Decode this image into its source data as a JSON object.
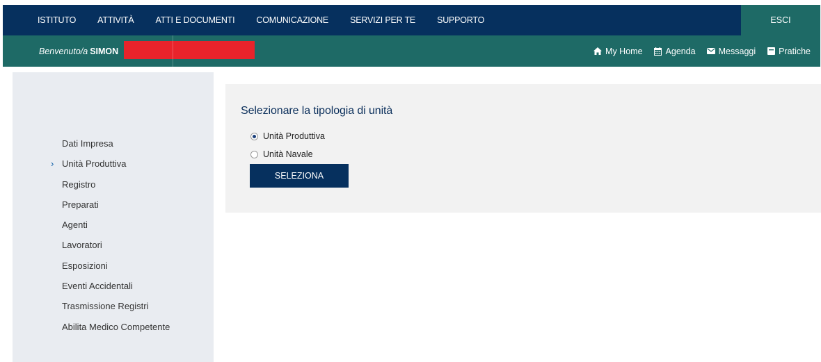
{
  "topnav": {
    "items": [
      "ISTITUTO",
      "ATTIVITÀ",
      "ATTI E DOCUMENTI",
      "COMUNICAZIONE",
      "SERVIZI PER TE",
      "SUPPORTO"
    ],
    "logout_label": "ESCI"
  },
  "subbar": {
    "welcome_label": "Benvenuto/a",
    "user_name": "SIMON",
    "links": [
      {
        "label": "My Home",
        "icon": "home-icon"
      },
      {
        "label": "Agenda",
        "icon": "calendar-icon"
      },
      {
        "label": "Messaggi",
        "icon": "envelope-icon"
      },
      {
        "label": "Pratiche",
        "icon": "folder-icon"
      }
    ]
  },
  "sidebar": {
    "active_marker": "›",
    "items": [
      {
        "label": "Dati Impresa",
        "active": false
      },
      {
        "label": "Unità Produttiva",
        "active": true
      },
      {
        "label": "Registro",
        "active": false
      },
      {
        "label": "Preparati",
        "active": false
      },
      {
        "label": "Agenti",
        "active": false
      },
      {
        "label": "Lavoratori",
        "active": false
      },
      {
        "label": "Esposizioni",
        "active": false
      },
      {
        "label": "Eventi Accidentali",
        "active": false
      },
      {
        "label": "Trasmissione Registri",
        "active": false
      },
      {
        "label": "Abilita Medico Competente",
        "active": false
      }
    ]
  },
  "main": {
    "title": "Selezionare la tipologia di unità",
    "options": [
      {
        "label": "Unità Produttiva",
        "checked": true
      },
      {
        "label": "Unità Navale",
        "checked": false
      }
    ],
    "submit_label": "SELEZIONA"
  },
  "colors": {
    "navy": "#06305e",
    "teal": "#1e6a66",
    "redaction": "#e8232b",
    "sidebar_bg": "#e9ecf1",
    "panel_bg": "#f2f2f2"
  }
}
